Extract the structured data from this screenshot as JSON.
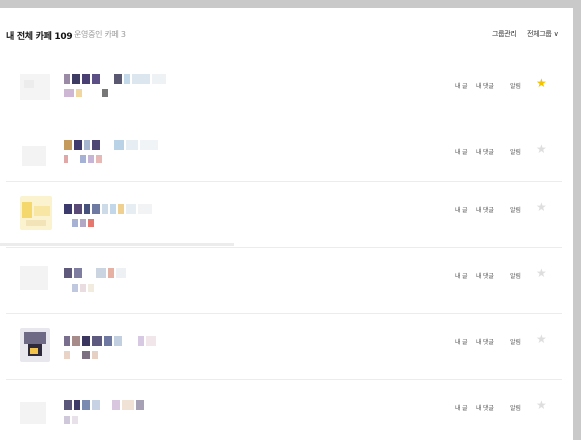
{
  "header": {
    "title": "내 전체 카페 109",
    "subtitle": "운영중인 카페 3",
    "group_settings": "그룹관리",
    "view_all": "전체그룹"
  },
  "rows": [
    {
      "my_posts": "내 글",
      "my_comments": "내 댓글",
      "notify": "알림",
      "starred": true
    },
    {
      "my_posts": "내 글",
      "my_comments": "내 댓글",
      "notify": "알림",
      "starred": false
    },
    {
      "my_posts": "내 글",
      "my_comments": "내 댓글",
      "notify": "알림",
      "starred": false
    },
    {
      "my_posts": "내 글",
      "my_comments": "내 댓글",
      "notify": "알림",
      "starred": false
    },
    {
      "my_posts": "내 글",
      "my_comments": "내 댓글",
      "notify": "알림",
      "starred": false
    },
    {
      "my_posts": "내 글",
      "my_comments": "내 댓글",
      "notify": "알림",
      "starred": false
    }
  ],
  "colors": {
    "star_on": "#f3c200",
    "star_off": "#dedede",
    "separator": "#ececec"
  }
}
